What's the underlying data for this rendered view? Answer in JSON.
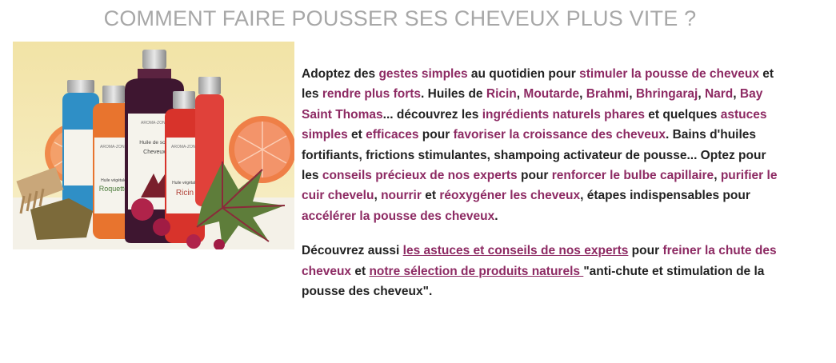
{
  "title": "COMMENT FAIRE POUSSER SES CHEVEUX PLUS VITE ?",
  "colors": {
    "title": "#a7a7a7",
    "text": "#222222",
    "highlight": "#8d2a63"
  },
  "image": {
    "alt": "Flacons Aroma-Zone : huiles de Ricin, Roquette et Huile de soin Cheveux",
    "bottles": [
      {
        "brand": "AROMA-ZONE",
        "lines": [
          "Huile végétale",
          "Roquette"
        ]
      },
      {
        "brand": "AROMA-ZONE",
        "lines": [
          "Huile de soin",
          "Cheveux"
        ]
      },
      {
        "brand": "AROMA-ZONE",
        "lines": [
          "Huile végétale",
          "Ricin"
        ]
      }
    ]
  },
  "p1": {
    "s1": "Adoptez des ",
    "h1": "gestes simples",
    "s2": " au quotidien pour ",
    "h2": "stimuler la pousse de cheveux",
    "s3": " et les ",
    "h3": "rendre plus forts",
    "s4": ". Huiles de ",
    "h4": "Ricin",
    "s5": ", ",
    "h5": "Moutarde",
    "s6": ", ",
    "h6": "Brahmi",
    "s7": ", ",
    "h7": "Bhringaraj",
    "s8": ", ",
    "h8": "Nard",
    "s9": ", ",
    "h9": "Bay Saint Thomas",
    "s10": "... découvrez les ",
    "h10": "ingrédients naturels phares",
    "s11": " et quelques ",
    "h11": "astuces simples",
    "s12": " et ",
    "h12": "efficaces",
    "s13": " pour ",
    "h13": "favoriser la croissance des cheveux",
    "s14": ". Bains d'huiles fortifiants, frictions stimulantes, shampoing activateur de pousse... Optez pour les ",
    "h14": "conseils précieux de nos experts",
    "s15": " pour ",
    "h15": "renforcer le bulbe capillaire",
    "s16": ", ",
    "h16": "purifier le cuir chevelu",
    "s17": ", ",
    "h17": "nourrir",
    "s18": " et ",
    "h18": "réoxygéner les cheveux",
    "s19": ", étapes indispensables pour ",
    "h19": "accélérer la pousse des cheveux",
    "s20": "."
  },
  "p2": {
    "s1": "Découvrez aussi ",
    "link1": "les astuces et conseils de nos experts",
    "s2": " pour ",
    "h1": "freiner la chute des cheveux",
    "s3": " et ",
    "link2": "notre sélection de produits naturels ",
    "s4": "\"anti-chute et stimulation de la pousse des cheveux\"."
  }
}
